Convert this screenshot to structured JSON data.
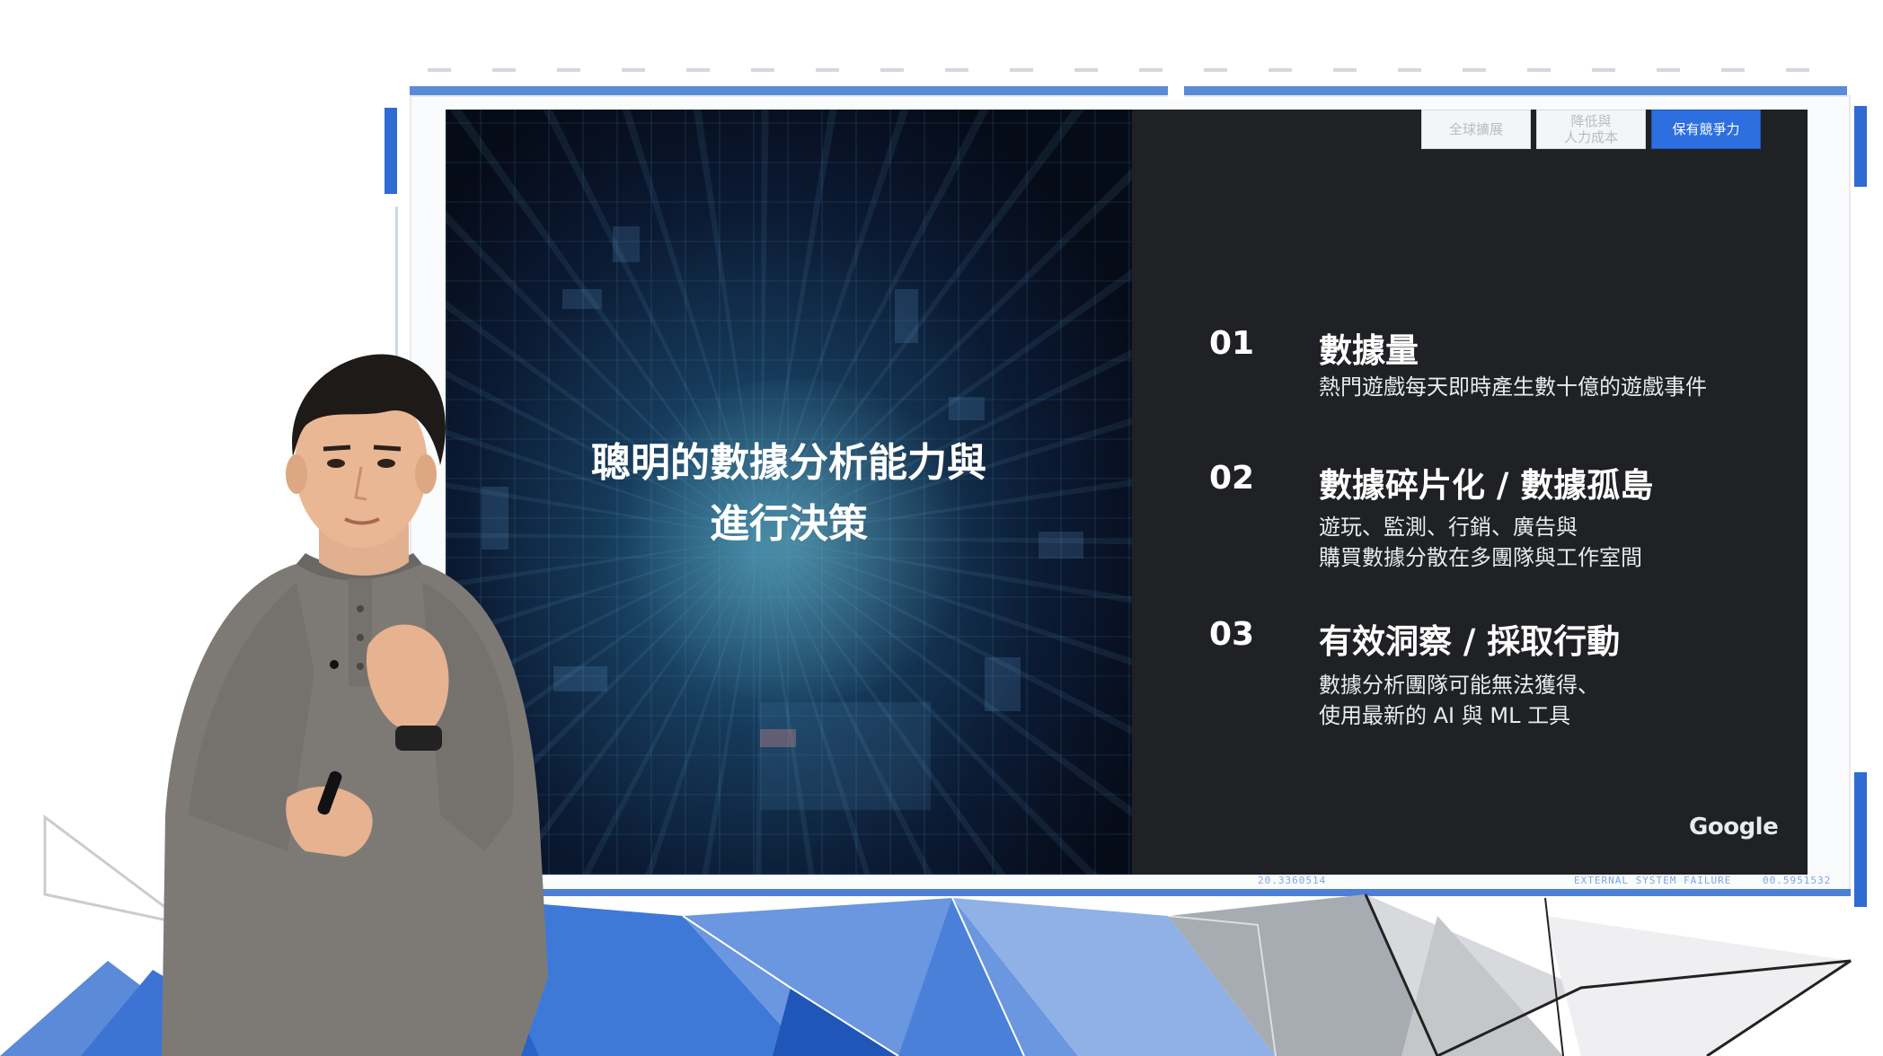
{
  "tabs": [
    {
      "label": "全球擴展"
    },
    {
      "label": "降低與\n人力成本"
    },
    {
      "label": "保有競爭力"
    }
  ],
  "slide": {
    "title": "聰明的數據分析能力與\n進行決策",
    "items": [
      {
        "num": "01",
        "title": "數據量",
        "desc": "熱門遊戲每天即時產生數十億的遊戲事件"
      },
      {
        "num": "02",
        "title": "數據碎片化 / 數據孤島",
        "desc": "遊玩、監測、行銷、廣告與\n購買數據分散在多團隊與工作室間"
      },
      {
        "num": "03",
        "title": "有效洞察 / 採取行動",
        "desc": "數據分析團隊可能無法獲得、\n使用最新的 AI 與 ML 工具"
      }
    ],
    "logo": "Google"
  },
  "hud": {
    "left": "20.3360514",
    "middle": "EXTERNAL SYSTEM FAILURE",
    "right": "00.5951532"
  },
  "colors": {
    "accent": "#2e6fe0",
    "slide_bg": "#202124",
    "frame": "#2f6bd1"
  }
}
